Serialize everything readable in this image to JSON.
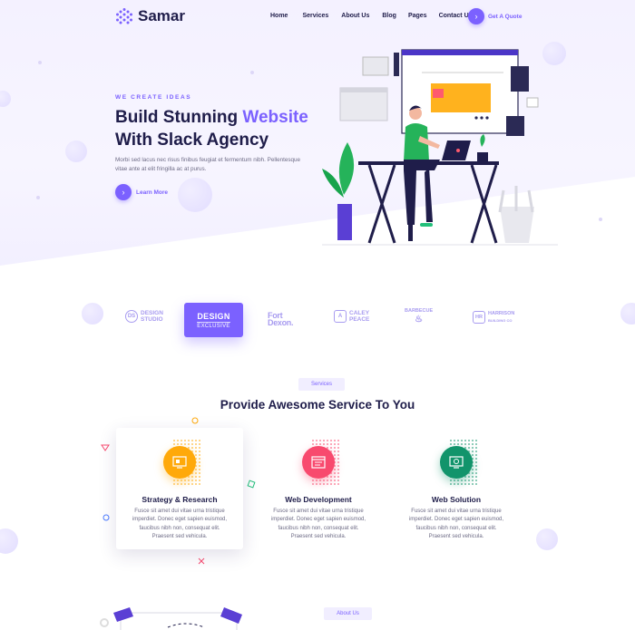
{
  "brand": {
    "name": "Samar"
  },
  "nav": {
    "items": [
      {
        "label": "Home"
      },
      {
        "label": "Services"
      },
      {
        "label": "About Us"
      },
      {
        "label": "Blog"
      },
      {
        "label": "Pages"
      },
      {
        "label": "Contact Us"
      }
    ],
    "cta_label": "Get A Quote"
  },
  "hero": {
    "eyebrow": "WE CREATE IDEAS",
    "title_part1": "Build Stunning ",
    "title_accent": "Website",
    "title_part2": "With Slack Agency",
    "description": "Morbi sed lacus nec risus finibus feugiat et fermentum nibh. Pellentesque vitae ante at elit fringilla ac at purus.",
    "learn_more": "Learn More"
  },
  "clients": [
    {
      "badge": "DS",
      "line1": "DESIGN",
      "line2": "STUDIO"
    },
    {
      "line1": "DESIGN",
      "line2": "EXCLUSIVE"
    },
    {
      "line1": "Fort",
      "line2": "Dexon."
    },
    {
      "badge": "A",
      "line1": "CALEY",
      "line2": "PEACE"
    },
    {
      "line1": "BARBECUE"
    },
    {
      "badge": "HR",
      "line1": "HARRISON",
      "line2": "BUILDING CO"
    }
  ],
  "services": {
    "pill": "Services",
    "title": "Provide Awesome Service To You",
    "items": [
      {
        "title": "Strategy & Research",
        "description": "Fusce sit amet dui vitae urna tristique imperdiet. Donec eget sapien euismod, faucibus nibh non, consequat elit. Praesent sed vehicula.",
        "color": "#ffa90a"
      },
      {
        "title": "Web Development",
        "description": "Fusce sit amet dui vitae urna tristique imperdiet. Donec eget sapien euismod, faucibus nibh non, consequat elit. Praesent sed vehicula.",
        "color": "#f84a6e"
      },
      {
        "title": "Web Solution",
        "description": "Fusce sit amet dui vitae urna tristique imperdiet. Donec eget sapien euismod, faucibus nibh non, consequat elit. Praesent sed vehicula.",
        "color": "#12946b"
      }
    ]
  },
  "about": {
    "pill": "About Us"
  },
  "colors": {
    "accent": "#7b61ff",
    "dark": "#1f1d4a",
    "muted": "#6d6b85"
  },
  "icons": [
    "hexagon-logo-icon",
    "arrow-right-icon",
    "strategy-icon",
    "web-development-icon",
    "web-solution-icon"
  ]
}
